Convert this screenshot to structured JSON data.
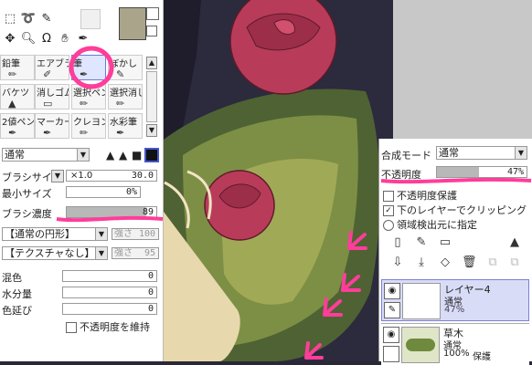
{
  "colors": {
    "primary_swatch": "#aaa58a",
    "highlight": "#ff3d9a",
    "selected_brush": "#dfe6ff",
    "layer_selected": "#d9dcf7"
  },
  "tool_panel": {
    "brushes_row1": [
      "鉛筆",
      "エアブラシ",
      "筆",
      "ぼかし"
    ],
    "brushes_row2": [
      "バケツ",
      "消しゴム",
      "選択ペン",
      "選択消し"
    ],
    "brushes_row3": [
      "2値ペン",
      "マーカー",
      "クレヨン",
      "水彩筆"
    ],
    "blend_mode": "通常",
    "brush_size_label": "ブラシサイズ",
    "brush_size_mult": "×1.0",
    "brush_size_value": "30.0",
    "min_size_label": "最小サイズ",
    "min_size_value": "0%",
    "density_label": "ブラシ濃度",
    "density_value": "89",
    "shape_combo": "【通常の円形】",
    "shape_strength_label": "強さ",
    "shape_strength_value": "100",
    "texture_combo": "【テクスチャなし】",
    "texture_strength_label": "強さ",
    "texture_strength_value": "95",
    "mix_label": "混色",
    "mix_value": "0",
    "water_label": "水分量",
    "water_value": "0",
    "stretch_label": "色延び",
    "stretch_value": "0",
    "keep_opacity_label": "不透明度を維持"
  },
  "layer_panel": {
    "blend_label": "合成モード",
    "blend_value": "通常",
    "opacity_label": "不透明度",
    "opacity_value": "47%",
    "opacity_fraction": 0.47,
    "protect_opacity_label": "不透明度保護",
    "clip_label": "下のレイヤーでクリッピング",
    "select_source_label": "領域検出元に指定",
    "layers": [
      {
        "name": "レイヤー4",
        "mode": "通常",
        "opacity": "47%",
        "extra": ""
      },
      {
        "name": "草木",
        "mode": "通常",
        "opacity": "100%",
        "extra": "保護"
      }
    ]
  }
}
